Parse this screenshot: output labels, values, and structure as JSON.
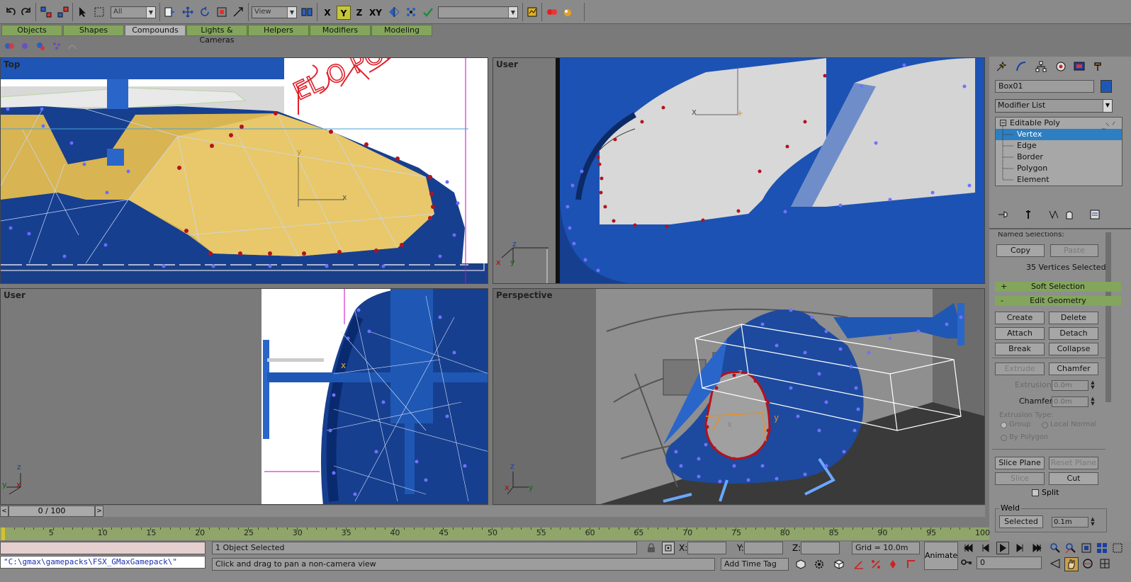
{
  "toolbar": {
    "selection_filter": "All",
    "coordinate_system": "View",
    "axis_x": "X",
    "axis_y": "Y",
    "axis_z": "Z",
    "axis_xy": "XY",
    "named_sets": ""
  },
  "tabs": [
    {
      "label": "Objects"
    },
    {
      "label": "Shapes"
    },
    {
      "label": "Compounds"
    },
    {
      "label": "Lights & Cameras"
    },
    {
      "label": "Helpers"
    },
    {
      "label": "Modifiers"
    },
    {
      "label": "Modeling"
    }
  ],
  "viewports": {
    "top_left": "Top",
    "top_right": "User",
    "bottom_left": "User",
    "bottom_right": "Perspective"
  },
  "annotation": "EL O POR",
  "command_panel": {
    "object_name": "Box01",
    "object_color": "#1f58b4",
    "modifier_list": "Modifier List",
    "stack": {
      "root": "Editable Poly",
      "items": [
        "Vertex",
        "Edge",
        "Border",
        "Polygon",
        "Element"
      ],
      "selected": "Vertex"
    },
    "named_selections": {
      "header": "Named Selections:",
      "copy": "Copy",
      "paste": "Paste",
      "status": "35 Vertices Selected"
    },
    "soft_selection": {
      "sign": "+",
      "label": "Soft Selection"
    },
    "edit_geometry": {
      "sign": "-",
      "label": "Edit Geometry",
      "create": "Create",
      "delete": "Delete",
      "attach": "Attach",
      "detach": "Detach",
      "break": "Break",
      "collapse": "Collapse",
      "extrude": "Extrude",
      "chamfer": "Chamfer",
      "extrusion_label": "Extrusion:",
      "extrusion_value": "0.0m",
      "chamfer_label": "Chamfer",
      "chamfer_value": "0.0m",
      "extrusion_type_label": "Extrusion Type:",
      "group": "Group",
      "local_normal": "Local Normal",
      "by_polygon": "By Polygon",
      "slice_plane": "Slice Plane",
      "reset_plane": "Reset Plane",
      "slice": "Slice",
      "cut": "Cut",
      "split": "Split",
      "weld_label": "Weld",
      "selected": "Selected",
      "weld_value": "0.1m"
    }
  },
  "time_slider": {
    "label": "0 / 100",
    "position": 0,
    "max": 100
  },
  "timeline": {
    "ticks": [
      "5",
      "10",
      "15",
      "20",
      "25",
      "30",
      "35",
      "40",
      "45",
      "50",
      "55",
      "60",
      "65",
      "70",
      "75",
      "80",
      "85",
      "90",
      "95",
      "100"
    ]
  },
  "status": {
    "script_path": "\"C:\\gmax\\gamepacks\\FSX_GMaxGamepack\\\"",
    "selected": "1 Object Selected",
    "prompt": "Click and drag to pan a non-camera view",
    "x_label": "X:",
    "y_label": "Y:",
    "z_label": "Z:",
    "grid": "Grid = 10.0m",
    "add_time_tag": "Add Time Tag",
    "animate": "Animate",
    "frame": "0"
  }
}
